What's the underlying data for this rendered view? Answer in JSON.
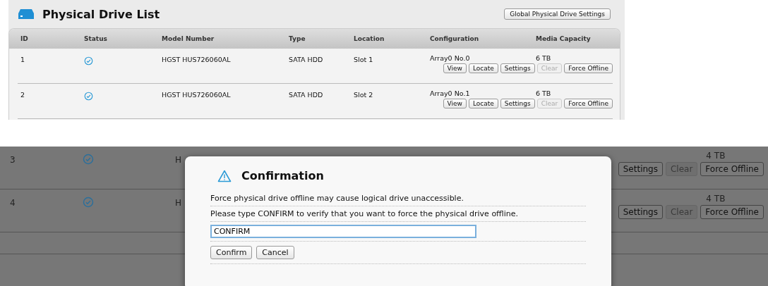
{
  "top": {
    "title": "Physical Drive List",
    "global_button": "Global Physical Drive Settings",
    "columns": [
      "ID",
      "Status",
      "Model Number",
      "Type",
      "Location",
      "Configuration",
      "Media Capacity"
    ],
    "rows": [
      {
        "id": "1",
        "model": "HGST HUS726060AL",
        "type": "SATA HDD",
        "location": "Slot 1",
        "configuration": "Array0 No.0",
        "capacity": "6 TB",
        "actions": [
          {
            "label": "View",
            "disabled": false
          },
          {
            "label": "Locate",
            "disabled": false
          },
          {
            "label": "Settings",
            "disabled": false
          },
          {
            "label": "Clear",
            "disabled": true
          },
          {
            "label": "Force Offline",
            "disabled": false
          }
        ]
      },
      {
        "id": "2",
        "model": "HGST HUS726060AL",
        "type": "SATA HDD",
        "location": "Slot 2",
        "configuration": "Array0 No.1",
        "capacity": "6 TB",
        "actions": [
          {
            "label": "View",
            "disabled": false
          },
          {
            "label": "Locate",
            "disabled": false
          },
          {
            "label": "Settings",
            "disabled": false
          },
          {
            "label": "Clear",
            "disabled": true
          },
          {
            "label": "Force Offline",
            "disabled": false
          }
        ]
      }
    ]
  },
  "bottom": {
    "rows": [
      {
        "id": "3",
        "model": "H",
        "capacity": "4 TB",
        "actions": [
          {
            "label": "Settings",
            "disabled": false
          },
          {
            "label": "Clear",
            "disabled": true
          },
          {
            "label": "Force Offline",
            "disabled": false
          }
        ]
      },
      {
        "id": "4",
        "model": "H",
        "capacity": "4 TB",
        "actions": [
          {
            "label": "Settings",
            "disabled": false
          },
          {
            "label": "Clear",
            "disabled": true
          },
          {
            "label": "Force Offline",
            "disabled": false
          }
        ]
      }
    ],
    "dialog": {
      "title": "Confirmation",
      "messages": [
        "Force physical drive offline may cause logical drive unaccessible.",
        "Please type CONFIRM to verify that you want to force the physical drive offline."
      ],
      "input_value": "CONFIRM",
      "buttons": [
        "Confirm",
        "Cancel"
      ]
    }
  }
}
